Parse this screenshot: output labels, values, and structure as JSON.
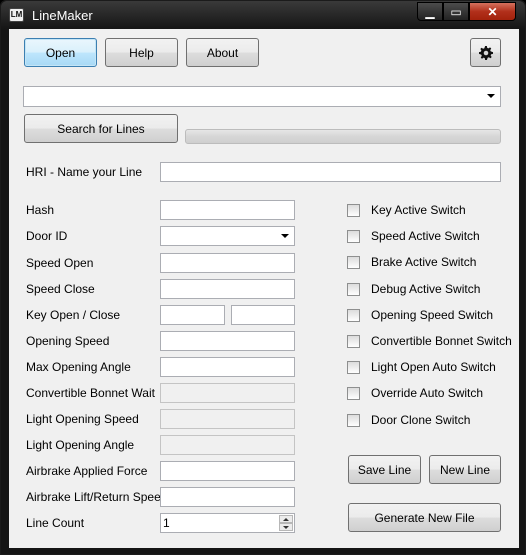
{
  "window": {
    "title": "LineMaker",
    "app_icon_text": "LM",
    "minimize_glyph": "▁",
    "maximize_glyph": "▭",
    "close_glyph": "✕"
  },
  "toolbar": {
    "open_label": "Open",
    "help_label": "Help",
    "about_label": "About",
    "settings_icon": "gear-icon"
  },
  "search": {
    "line_select_value": "",
    "search_button_label": "Search for Lines",
    "progress_percent": 0
  },
  "form": {
    "hri_label": "HRI - Name your Line",
    "hri_value": "",
    "fields": {
      "hash": {
        "label": "Hash",
        "value": ""
      },
      "door_id": {
        "label": "Door ID",
        "value": ""
      },
      "speed_open": {
        "label": "Speed Open",
        "value": ""
      },
      "speed_close": {
        "label": "Speed Close",
        "value": ""
      },
      "key_open_close": {
        "label": "Key Open / Close",
        "open_value": "",
        "close_value": ""
      },
      "opening_speed": {
        "label": "Opening Speed",
        "value": ""
      },
      "max_opening_angle": {
        "label": "Max Opening Angle",
        "value": ""
      },
      "convertible_bonnet_wait": {
        "label": "Convertible Bonnet Wait",
        "value": ""
      },
      "light_opening_speed": {
        "label": "Light Opening Speed",
        "value": ""
      },
      "light_opening_angle": {
        "label": "Light Opening Angle",
        "value": ""
      },
      "airbrake_applied_force": {
        "label": "Airbrake Applied Force",
        "value": ""
      },
      "airbrake_lift_return_speed": {
        "label": "Airbrake Lift/Return Speed",
        "value": ""
      },
      "line_count": {
        "label": "Line Count",
        "value": "1"
      }
    }
  },
  "switches": [
    {
      "label": "Key Active Switch",
      "checked": false
    },
    {
      "label": "Speed Active Switch",
      "checked": false
    },
    {
      "label": "Brake Active Switch",
      "checked": false
    },
    {
      "label": "Debug Active Switch",
      "checked": false
    },
    {
      "label": "Opening Speed Switch",
      "checked": false
    },
    {
      "label": "Convertible Bonnet Switch",
      "checked": false
    },
    {
      "label": "Light Open Auto Switch",
      "checked": false
    },
    {
      "label": "Override Auto Switch",
      "checked": false
    },
    {
      "label": "Door Clone Switch",
      "checked": false
    }
  ],
  "actions": {
    "save_line_label": "Save Line",
    "new_line_label": "New Line",
    "generate_label": "Generate New File"
  }
}
